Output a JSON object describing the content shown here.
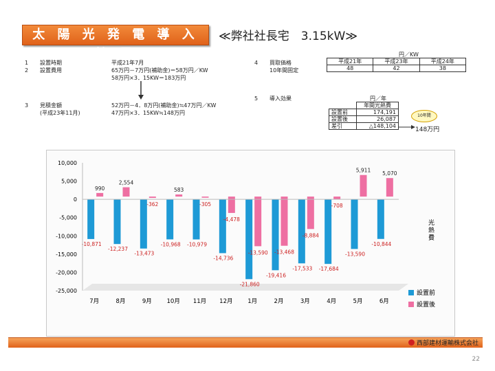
{
  "title": "太 陽 光 発 電 導 入 効 果",
  "subtitle": "≪弊社社長宅　3.15kW≫",
  "info_left": [
    {
      "num": "1",
      "label": "設置時期",
      "value": "平成21年7月"
    },
    {
      "num": "2",
      "label": "設置費用",
      "value": "65万円－7万円(補助金)＝58万円／KW"
    },
    {
      "num": "",
      "label": "",
      "value": "58万円×3．15KW＝183万円"
    }
  ],
  "info_left2": [
    {
      "num": "3",
      "label": "見積金額",
      "value": "52万円－4．8万円(補助金)≒47万円／KW"
    },
    {
      "num": "",
      "label": "(平成23年11月)",
      "value": "47万円×3．15KW≒148万円"
    }
  ],
  "purchase": {
    "num": "4",
    "label": "買取価格",
    "sub": "10年間固定",
    "unit": "円／KW",
    "headers": [
      "平成21年",
      "平成23年",
      "平成24年"
    ],
    "values": [
      "48",
      "42",
      "38"
    ]
  },
  "effect": {
    "num": "5",
    "label": "導入効果",
    "unit": "円／年",
    "header": "年間光熱費",
    "rows": [
      {
        "label": "設置前",
        "value": "174,191"
      },
      {
        "label": "設置後",
        "value": "26,087"
      },
      {
        "label": "差引",
        "value": "△148,104"
      }
    ],
    "ten_year_label": "10年間",
    "ten_year_value": "148万円"
  },
  "company": "西部建材運輸株式会社",
  "page_number": "22",
  "colors": {
    "before": "#1e9ad6",
    "after": "#ee6fa2",
    "label_red": "#cc1f1f"
  },
  "chart_data": {
    "type": "bar",
    "categories": [
      "7月",
      "8月",
      "9月",
      "10月",
      "11月",
      "12月",
      "1月",
      "2月",
      "3月",
      "4月",
      "5月",
      "6月"
    ],
    "series": [
      {
        "name": "設置前",
        "values": [
          -10871,
          -12237,
          -13473,
          -10968,
          -10979,
          -14736,
          -21860,
          -19416,
          -17533,
          -17684,
          -13590,
          -10844
        ]
      },
      {
        "name": "設置後",
        "values": [
          990,
          2554,
          -362,
          583,
          -305,
          -4478,
          -13590,
          -13468,
          -8884,
          -708,
          5911,
          5070
        ]
      }
    ],
    "before_labels": [
      "-10,871",
      "-12,237",
      "-13,473",
      "-10,968",
      "-10,979",
      "-14,736",
      "-21,860",
      "-19,416",
      "-17,533",
      "-17,684",
      "-13,590",
      "-10,844"
    ],
    "after_labels": [
      "990",
      "2,554",
      "-362",
      "583",
      "-305",
      "-4,478",
      "-13,590",
      "-13,468",
      "-8,884",
      "-708",
      "5,911",
      "5,070"
    ],
    "ylabel": "光熱費",
    "ylim": [
      -25000,
      10000
    ],
    "yticks": [
      10000,
      5000,
      0,
      -5000,
      -10000,
      -15000,
      -20000,
      -25000
    ],
    "ytick_labels": [
      "10,000",
      "5,000",
      "0",
      "-5,000",
      "-10,000",
      "-15,000",
      "-20,000",
      "-25,000"
    ],
    "legend_position": "right",
    "grid": false
  }
}
